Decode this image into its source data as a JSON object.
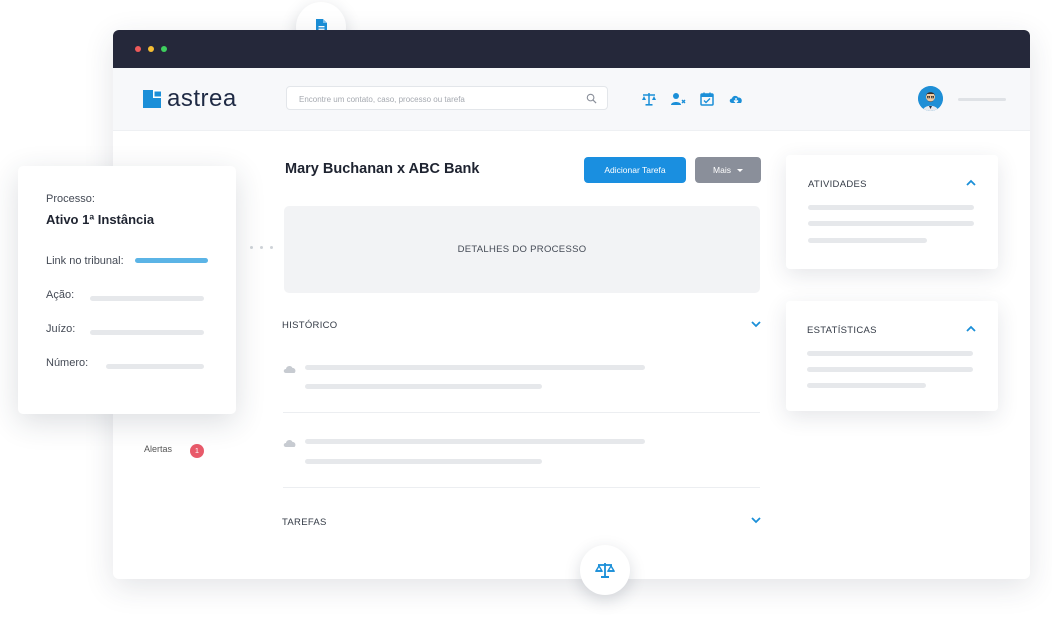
{
  "app": {
    "logo_text": "astrea",
    "search_placeholder": "Encontre um contato, caso, processo ou tarefa"
  },
  "header_icons": [
    "scales-icon",
    "user-remove-icon",
    "calendar-check-icon",
    "cloud-download-icon"
  ],
  "case": {
    "title": "Mary Buchanan x ABC Bank",
    "primary_button": "Adicionar Tarefa",
    "secondary_button": "Mais"
  },
  "details_panel": {
    "label": "DETALHES DO PROCESSO"
  },
  "sections": {
    "history": "HISTÓRICO",
    "tasks": "TAREFAS"
  },
  "sidebar": {
    "alerts_label": "Alertas",
    "alerts_count": "1"
  },
  "right_cards": {
    "activities": "ATIVIDADES",
    "statistics": "ESTATÍSTICAS"
  },
  "process_card": {
    "process_label": "Processo:",
    "process_value": "Ativo 1ª Instância",
    "link_label": "Link no tribunal:",
    "action_label": "Ação:",
    "court_label": "Juízo:",
    "number_label": "Número:"
  },
  "colors": {
    "titlebar": "#25283a",
    "primary": "#1a8fe0",
    "secondary": "#8a8f9a",
    "accent_link": "#5bb4e6",
    "badge": "#e85a6a",
    "icon_blue": "#1b8fd8"
  }
}
